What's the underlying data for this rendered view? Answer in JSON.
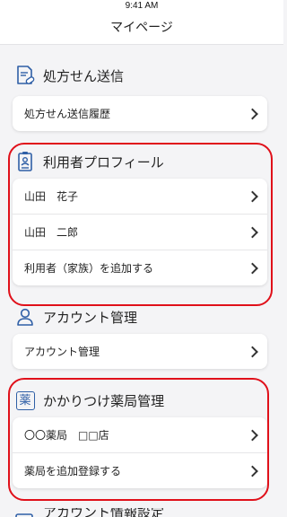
{
  "status": {
    "time": "9:41 AM"
  },
  "header": {
    "title": "マイページ"
  },
  "prescription": {
    "title": "処方せん送信",
    "items": [
      {
        "label": "処方せん送信履歴"
      }
    ]
  },
  "profiles": {
    "title": "利用者プロフィール",
    "items": [
      {
        "label": "山田　花子"
      },
      {
        "label": "山田　二郎"
      },
      {
        "label": "利用者（家族）を追加する"
      }
    ]
  },
  "account": {
    "title": "アカウント管理",
    "items": [
      {
        "label": "アカウント管理"
      }
    ]
  },
  "pharmacy": {
    "title": "かかりつけ薬局管理",
    "icon_char": "薬",
    "items": [
      {
        "label": "〇〇薬局　□□店"
      },
      {
        "label": "薬局を追加登録する"
      }
    ]
  },
  "next_section": {
    "title": "アカウント情報設定"
  },
  "colors": {
    "highlight": "#e0101a",
    "icon_blue": "#2f5fa6"
  }
}
